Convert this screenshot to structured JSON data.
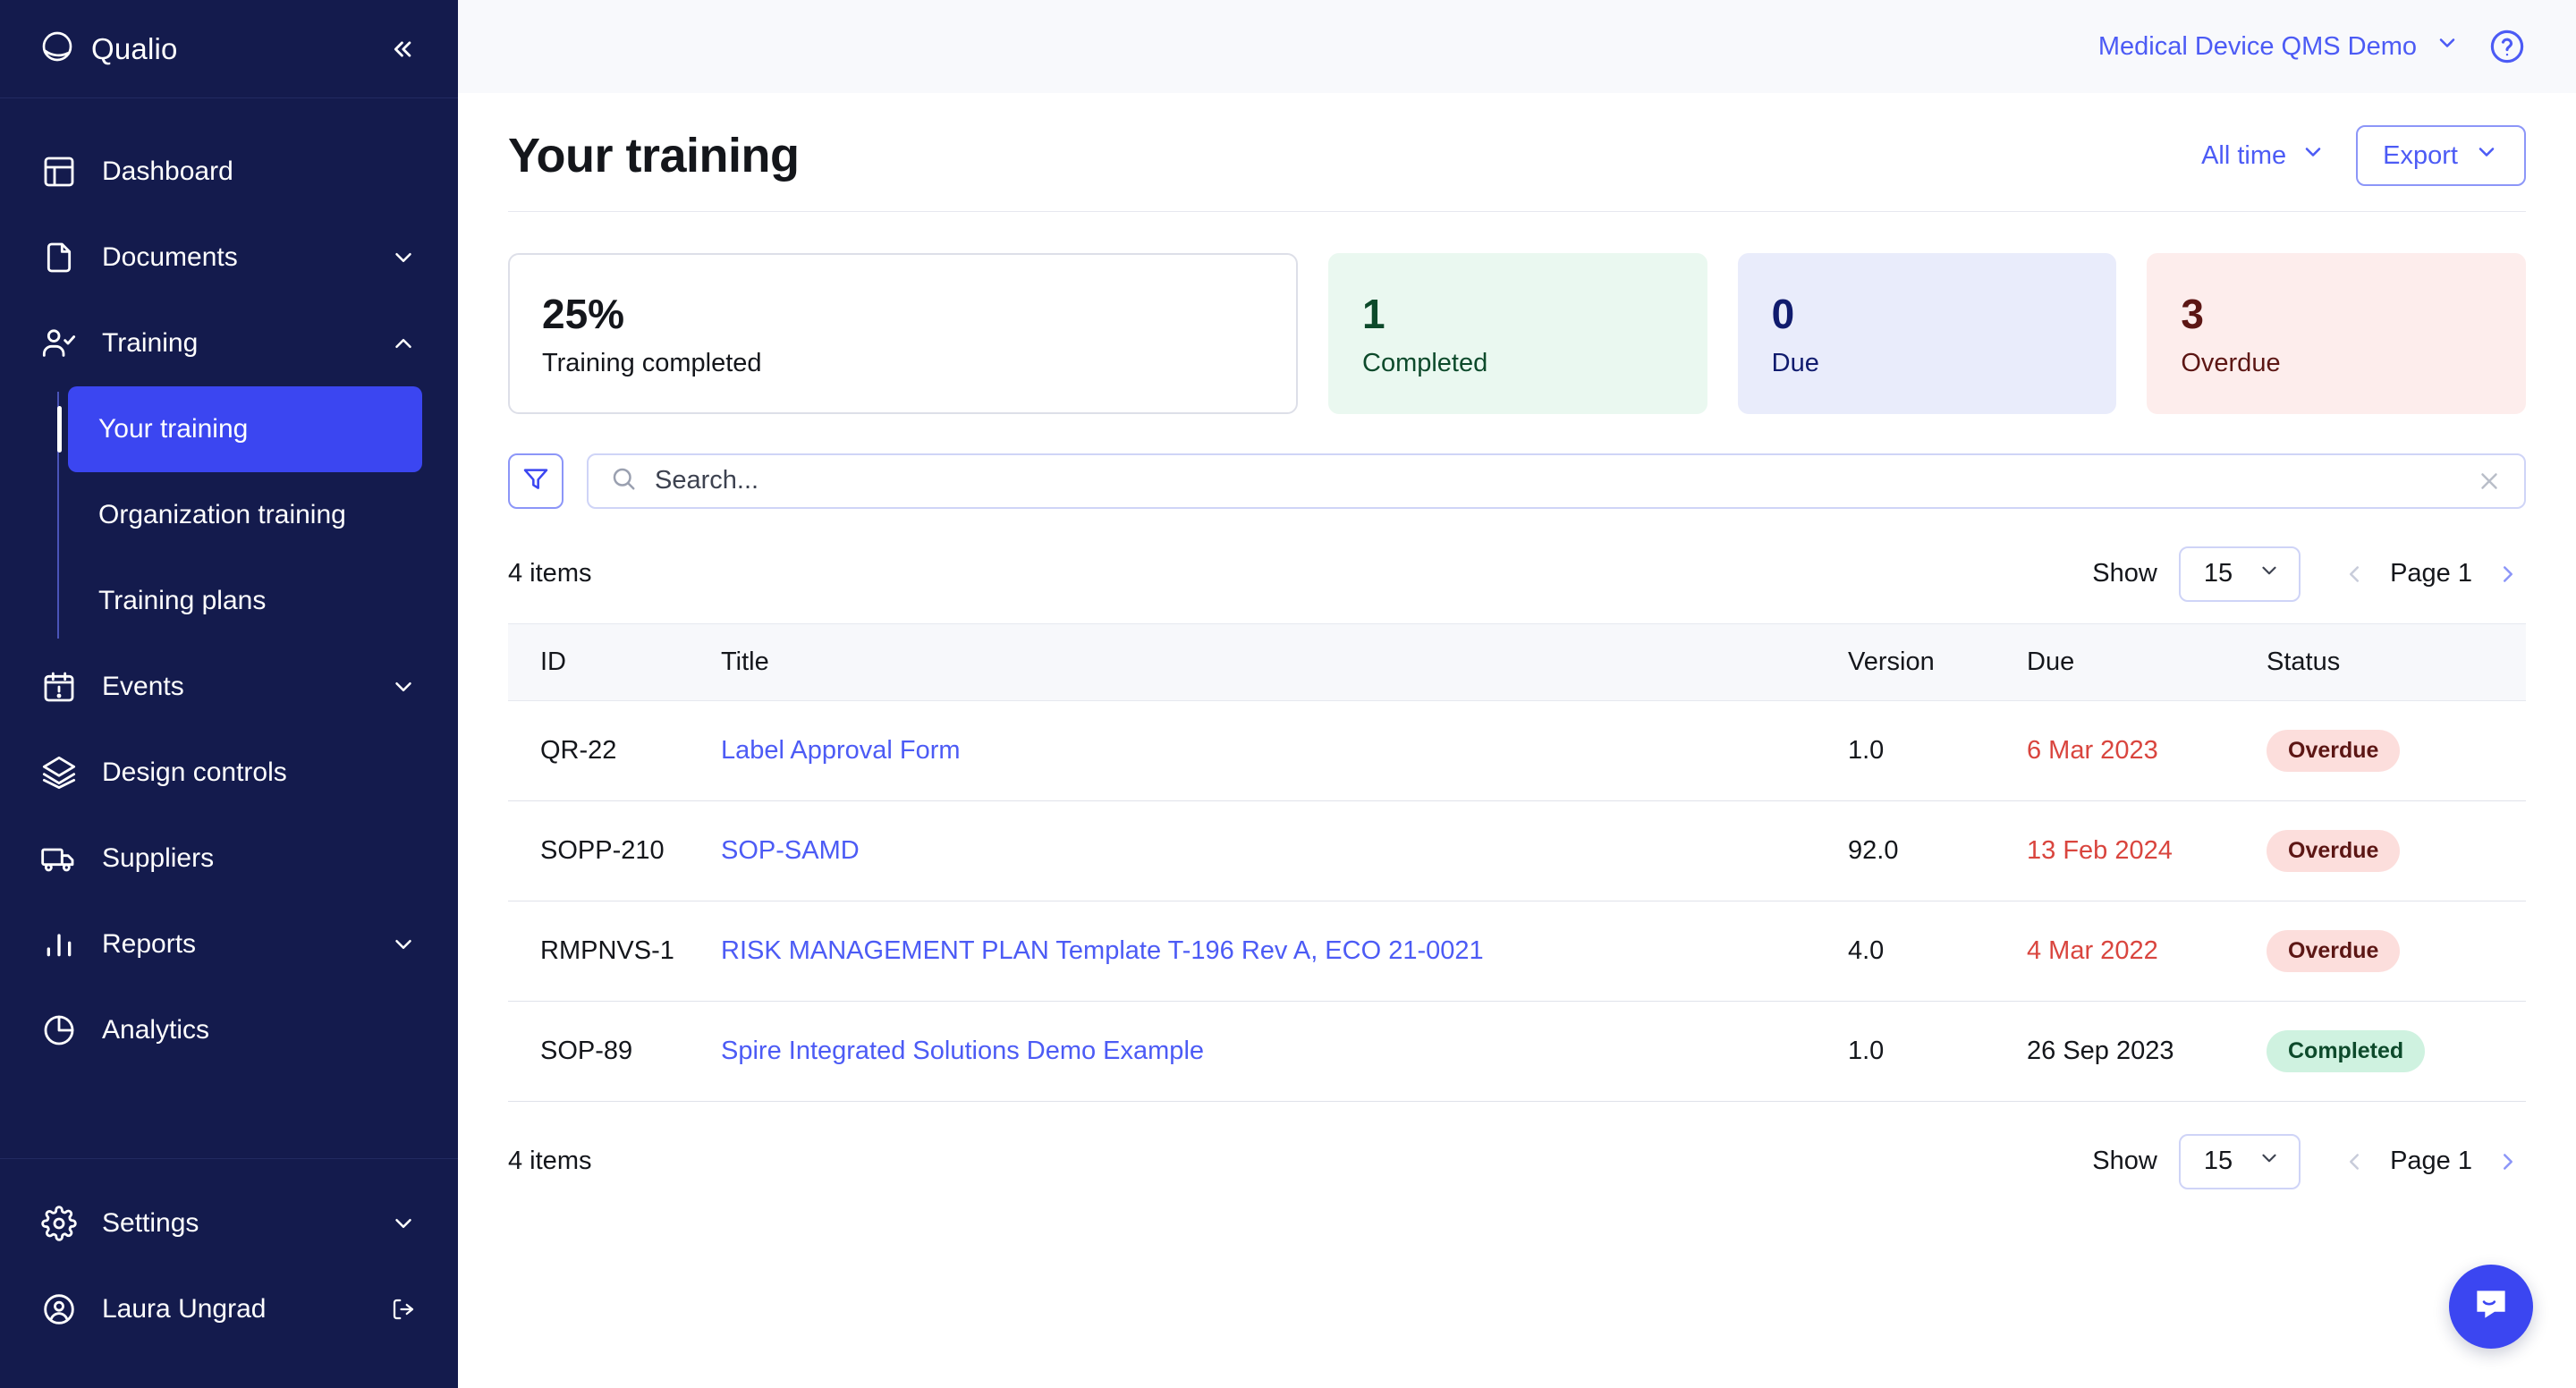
{
  "sidebar": {
    "brand": "Qualio",
    "collapse_label": "«",
    "items": [
      {
        "label": "Dashboard",
        "icon": "dashboard-icon",
        "expandable": false
      },
      {
        "label": "Documents",
        "icon": "document-icon",
        "expandable": true,
        "expanded": false
      },
      {
        "label": "Training",
        "icon": "user-check-icon",
        "expandable": true,
        "expanded": true
      },
      {
        "label": "Events",
        "icon": "calendar-alert-icon",
        "expandable": true,
        "expanded": false
      },
      {
        "label": "Design controls",
        "icon": "layers-icon",
        "expandable": false
      },
      {
        "label": "Suppliers",
        "icon": "truck-icon",
        "expandable": false
      },
      {
        "label": "Reports",
        "icon": "bar-chart-icon",
        "expandable": true,
        "expanded": false
      },
      {
        "label": "Analytics",
        "icon": "pie-chart-icon",
        "expandable": false
      }
    ],
    "training_submenu": [
      {
        "label": "Your training",
        "active": true
      },
      {
        "label": "Organization training",
        "active": false
      },
      {
        "label": "Training plans",
        "active": false
      }
    ],
    "footer": {
      "settings_label": "Settings",
      "user_name": "Laura Ungrad"
    }
  },
  "topbar": {
    "org_name": "Medical Device QMS Demo",
    "help_icon": "help-circle-icon"
  },
  "page": {
    "title": "Your training",
    "time_filter": "All time",
    "export_label": "Export"
  },
  "stats": [
    {
      "value": "25%",
      "label": "Training completed",
      "variant": "primary",
      "bg": "#FFFFFF",
      "fg": "#14161B"
    },
    {
      "value": "1",
      "label": "Completed",
      "variant": "tint",
      "bg": "#EAF8F0",
      "fg": "#0D4A2B"
    },
    {
      "value": "0",
      "label": "Due",
      "variant": "tint",
      "bg": "#E9ECFB",
      "fg": "#101B6E"
    },
    {
      "value": "3",
      "label": "Overdue",
      "variant": "tint",
      "bg": "#FDEDEC",
      "fg": "#5C1614"
    }
  ],
  "search": {
    "placeholder": "Search...",
    "value": "",
    "filter_icon": "filter-funnel-icon",
    "search_icon": "search-icon",
    "clear_icon": "close-icon"
  },
  "pagination": {
    "items_count": "4 items",
    "show_label": "Show",
    "page_size": "15",
    "page_label": "Page 1",
    "prev_icon": "chevron-left-icon",
    "next_icon": "chevron-right-icon"
  },
  "table": {
    "columns": [
      "ID",
      "Title",
      "Version",
      "Due",
      "Status"
    ],
    "rows": [
      {
        "id": "QR-22",
        "title": "Label Approval Form",
        "version": "1.0",
        "due": "6 Mar 2023",
        "due_overdue": true,
        "status": "Overdue",
        "status_variant": "overdue"
      },
      {
        "id": "SOPP-210",
        "title": "SOP-SAMD",
        "version": "92.0",
        "due": "13 Feb 2024",
        "due_overdue": true,
        "status": "Overdue",
        "status_variant": "overdue"
      },
      {
        "id": "RMPNVS-1",
        "title": "RISK MANAGEMENT PLAN Template T-196 Rev A, ECO 21-0021",
        "version": "4.0",
        "due": "4 Mar 2022",
        "due_overdue": true,
        "status": "Overdue",
        "status_variant": "overdue"
      },
      {
        "id": "SOP-89",
        "title": "Spire Integrated Solutions Demo Example",
        "version": "1.0",
        "due": "26 Sep 2023",
        "due_overdue": false,
        "status": "Completed",
        "status_variant": "completed"
      }
    ]
  },
  "chat": {
    "icon": "chat-bubble-icon"
  },
  "colors": {
    "sidebar_bg": "#141B4D",
    "accent": "#3B46F1",
    "link": "#4C5BF5",
    "danger": "#D9453E",
    "success": "#0D4A2B"
  }
}
